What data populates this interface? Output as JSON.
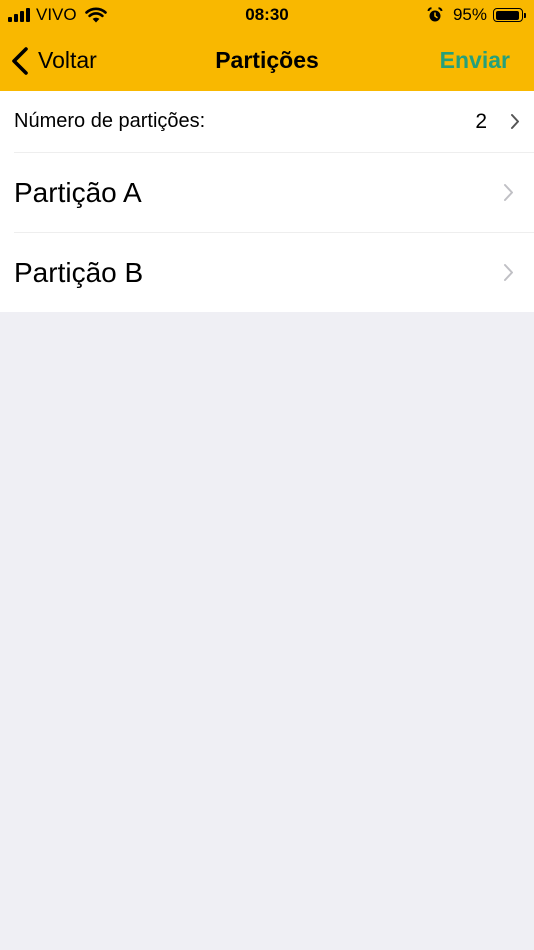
{
  "status_bar": {
    "carrier": "VIVO",
    "time": "08:30",
    "battery_percent": "95%",
    "battery_level": 0.95,
    "icons": [
      "signal-icon",
      "wifi-icon",
      "alarm-icon",
      "battery-icon"
    ]
  },
  "nav": {
    "back_label": "Voltar",
    "title": "Partições",
    "action_label": "Enviar",
    "accent_color": "#f9b800",
    "action_color": "#26a07a"
  },
  "settings": {
    "count_label": "Número de partições:",
    "count_value": "2",
    "partitions": [
      {
        "label": "Partição A"
      },
      {
        "label": "Partição B"
      }
    ]
  }
}
